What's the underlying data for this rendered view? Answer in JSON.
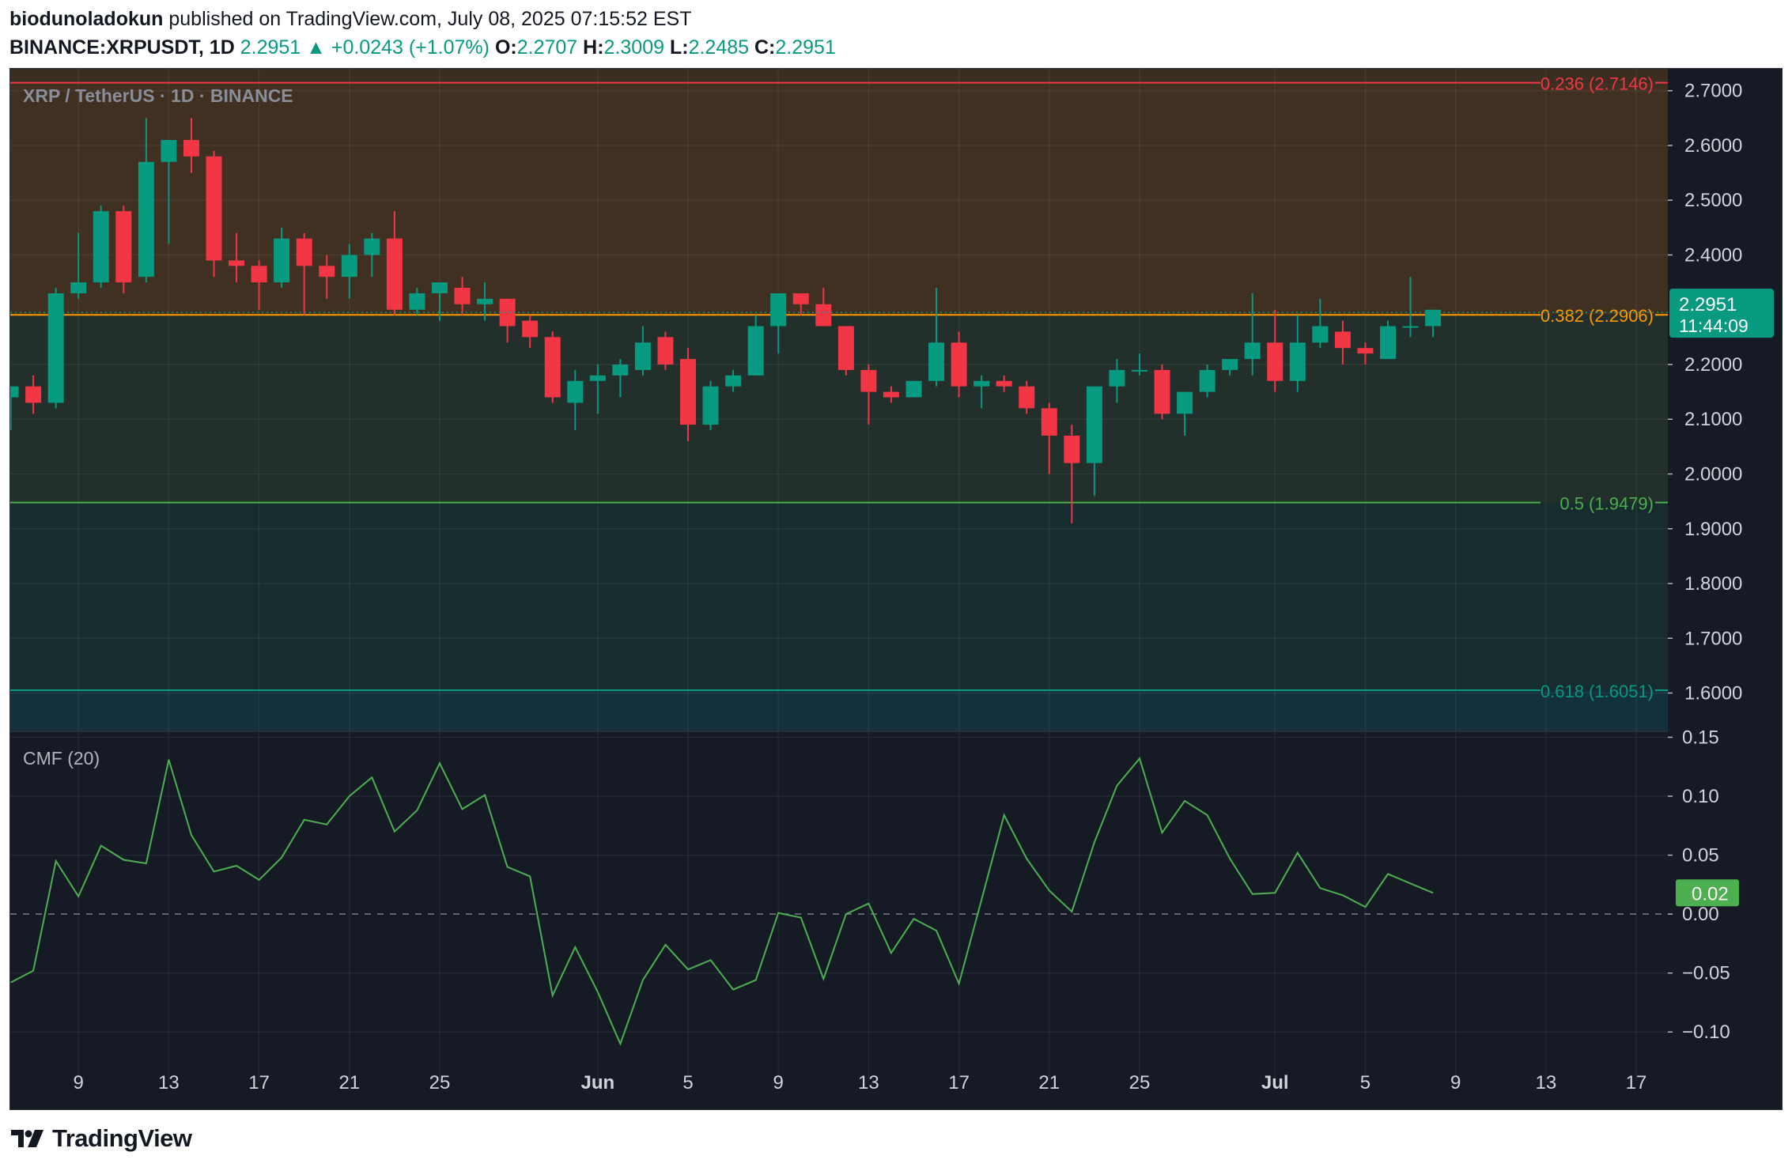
{
  "header": {
    "author": "biodunoladokun",
    "published_text": "published on TradingView.com, July 08, 2025 07:15:52 EST",
    "symbol_line": "BINANCE:XRPUSDT, 1D",
    "last_price": "2.2951",
    "change_arrow": "▲",
    "change": "+0.0243 (+1.07%)",
    "ohlc": [
      {
        "label": "O:",
        "value": "2.2707"
      },
      {
        "label": "H:",
        "value": "2.3009"
      },
      {
        "label": "L:",
        "value": "2.2485"
      },
      {
        "label": "C:",
        "value": "2.2951"
      }
    ]
  },
  "colors": {
    "up": "#089981",
    "down": "#f23645",
    "cmf_line": "#4caf50",
    "fib_0236": "#f23645",
    "fib_0382": "#ff9800",
    "fib_05": "#4caf50",
    "fib_0618": "#089981",
    "price_label_bg": "#089981",
    "cmf_label_bg": "#4caf50"
  },
  "footer": {
    "logo_icon": "tradingview-logo-icon",
    "logo_text": "TradingView"
  },
  "chart_data": [
    {
      "type": "candlestick",
      "title": "XRP / TetherUS · 1D · BINANCE",
      "y_ticks": [
        "2.7000",
        "2.6000",
        "2.5000",
        "2.4000",
        "2.2000",
        "2.1000",
        "2.0000",
        "1.9000",
        "1.8000",
        "1.7000",
        "1.6000"
      ],
      "ylim": [
        1.53,
        2.74
      ],
      "x_tick_labels": [
        {
          "label": "9",
          "day": 6
        },
        {
          "label": "13",
          "day": 10
        },
        {
          "label": "17",
          "day": 14
        },
        {
          "label": "21",
          "day": 18
        },
        {
          "label": "25",
          "day": 22
        },
        {
          "label": "Jun",
          "day": 29
        },
        {
          "label": "5",
          "day": 33
        },
        {
          "label": "9",
          "day": 37
        },
        {
          "label": "13",
          "day": 41
        },
        {
          "label": "17",
          "day": 45
        },
        {
          "label": "21",
          "day": 49
        },
        {
          "label": "25",
          "day": 53
        },
        {
          "label": "Jul",
          "day": 59
        },
        {
          "label": "5",
          "day": 63
        },
        {
          "label": "9",
          "day": 67
        },
        {
          "label": "13",
          "day": 71
        },
        {
          "label": "17",
          "day": 75
        }
      ],
      "x_range_days": [
        2.98,
        76.4
      ],
      "candles": [
        {
          "day": 3,
          "o": 2.14,
          "h": 2.16,
          "l": 2.08,
          "c": 2.16
        },
        {
          "day": 4,
          "o": 2.16,
          "h": 2.18,
          "l": 2.11,
          "c": 2.13
        },
        {
          "day": 5,
          "o": 2.13,
          "h": 2.34,
          "l": 2.12,
          "c": 2.33
        },
        {
          "day": 6,
          "o": 2.33,
          "h": 2.44,
          "l": 2.32,
          "c": 2.35
        },
        {
          "day": 7,
          "o": 2.35,
          "h": 2.49,
          "l": 2.34,
          "c": 2.48
        },
        {
          "day": 8,
          "o": 2.48,
          "h": 2.49,
          "l": 2.33,
          "c": 2.35
        },
        {
          "day": 9,
          "o": 2.36,
          "h": 2.65,
          "l": 2.35,
          "c": 2.57
        },
        {
          "day": 10,
          "o": 2.57,
          "h": 2.61,
          "l": 2.42,
          "c": 2.61
        },
        {
          "day": 11,
          "o": 2.61,
          "h": 2.65,
          "l": 2.55,
          "c": 2.58
        },
        {
          "day": 12,
          "o": 2.58,
          "h": 2.59,
          "l": 2.36,
          "c": 2.39
        },
        {
          "day": 13,
          "o": 2.39,
          "h": 2.44,
          "l": 2.35,
          "c": 2.38
        },
        {
          "day": 14,
          "o": 2.38,
          "h": 2.39,
          "l": 2.3,
          "c": 2.35
        },
        {
          "day": 15,
          "o": 2.35,
          "h": 2.45,
          "l": 2.34,
          "c": 2.43
        },
        {
          "day": 16,
          "o": 2.43,
          "h": 2.44,
          "l": 2.29,
          "c": 2.38
        },
        {
          "day": 17,
          "o": 2.38,
          "h": 2.4,
          "l": 2.32,
          "c": 2.36
        },
        {
          "day": 18,
          "o": 2.36,
          "h": 2.42,
          "l": 2.32,
          "c": 2.4
        },
        {
          "day": 19,
          "o": 2.4,
          "h": 2.44,
          "l": 2.36,
          "c": 2.43
        },
        {
          "day": 20,
          "o": 2.43,
          "h": 2.48,
          "l": 2.29,
          "c": 2.3
        },
        {
          "day": 21,
          "o": 2.3,
          "h": 2.34,
          "l": 2.29,
          "c": 2.33
        },
        {
          "day": 22,
          "o": 2.33,
          "h": 2.35,
          "l": 2.28,
          "c": 2.35
        },
        {
          "day": 23,
          "o": 2.34,
          "h": 2.36,
          "l": 2.29,
          "c": 2.31
        },
        {
          "day": 24,
          "o": 2.31,
          "h": 2.35,
          "l": 2.28,
          "c": 2.32
        },
        {
          "day": 25,
          "o": 2.32,
          "h": 2.32,
          "l": 2.24,
          "c": 2.27
        },
        {
          "day": 26,
          "o": 2.28,
          "h": 2.29,
          "l": 2.23,
          "c": 2.25
        },
        {
          "day": 27,
          "o": 2.25,
          "h": 2.26,
          "l": 2.13,
          "c": 2.14
        },
        {
          "day": 28,
          "o": 2.13,
          "h": 2.19,
          "l": 2.08,
          "c": 2.17
        },
        {
          "day": 29,
          "o": 2.17,
          "h": 2.2,
          "l": 2.11,
          "c": 2.18
        },
        {
          "day": 30,
          "o": 2.18,
          "h": 2.21,
          "l": 2.14,
          "c": 2.2
        },
        {
          "day": 31,
          "o": 2.19,
          "h": 2.27,
          "l": 2.18,
          "c": 2.24
        },
        {
          "day": 32,
          "o": 2.25,
          "h": 2.26,
          "l": 2.19,
          "c": 2.2
        },
        {
          "day": 33,
          "o": 2.21,
          "h": 2.23,
          "l": 2.06,
          "c": 2.09
        },
        {
          "day": 34,
          "o": 2.09,
          "h": 2.17,
          "l": 2.08,
          "c": 2.16
        },
        {
          "day": 35,
          "o": 2.16,
          "h": 2.19,
          "l": 2.15,
          "c": 2.18
        },
        {
          "day": 36,
          "o": 2.18,
          "h": 2.29,
          "l": 2.18,
          "c": 2.27
        },
        {
          "day": 37,
          "o": 2.27,
          "h": 2.33,
          "l": 2.22,
          "c": 2.33
        },
        {
          "day": 38,
          "o": 2.33,
          "h": 2.33,
          "l": 2.29,
          "c": 2.31
        },
        {
          "day": 39,
          "o": 2.31,
          "h": 2.34,
          "l": 2.27,
          "c": 2.27
        },
        {
          "day": 40,
          "o": 2.27,
          "h": 2.27,
          "l": 2.18,
          "c": 2.19
        },
        {
          "day": 41,
          "o": 2.19,
          "h": 2.2,
          "l": 2.09,
          "c": 2.15
        },
        {
          "day": 42,
          "o": 2.15,
          "h": 2.16,
          "l": 2.13,
          "c": 2.14
        },
        {
          "day": 43,
          "o": 2.14,
          "h": 2.17,
          "l": 2.14,
          "c": 2.17
        },
        {
          "day": 44,
          "o": 2.17,
          "h": 2.34,
          "l": 2.16,
          "c": 2.24
        },
        {
          "day": 45,
          "o": 2.24,
          "h": 2.26,
          "l": 2.14,
          "c": 2.16
        },
        {
          "day": 46,
          "o": 2.16,
          "h": 2.18,
          "l": 2.12,
          "c": 2.17
        },
        {
          "day": 47,
          "o": 2.17,
          "h": 2.18,
          "l": 2.15,
          "c": 2.16
        },
        {
          "day": 48,
          "o": 2.16,
          "h": 2.17,
          "l": 2.11,
          "c": 2.12
        },
        {
          "day": 49,
          "o": 2.12,
          "h": 2.13,
          "l": 2.0,
          "c": 2.07
        },
        {
          "day": 50,
          "o": 2.07,
          "h": 2.09,
          "l": 1.91,
          "c": 2.02
        },
        {
          "day": 51,
          "o": 2.02,
          "h": 2.16,
          "l": 1.96,
          "c": 2.16
        },
        {
          "day": 52,
          "o": 2.16,
          "h": 2.21,
          "l": 2.13,
          "c": 2.19
        },
        {
          "day": 53,
          "o": 2.19,
          "h": 2.22,
          "l": 2.18,
          "c": 2.19
        },
        {
          "day": 54,
          "o": 2.19,
          "h": 2.2,
          "l": 2.1,
          "c": 2.11
        },
        {
          "day": 55,
          "o": 2.11,
          "h": 2.14,
          "l": 2.07,
          "c": 2.15
        },
        {
          "day": 56,
          "o": 2.15,
          "h": 2.2,
          "l": 2.14,
          "c": 2.19
        },
        {
          "day": 57,
          "o": 2.19,
          "h": 2.21,
          "l": 2.18,
          "c": 2.21
        },
        {
          "day": 58,
          "o": 2.21,
          "h": 2.33,
          "l": 2.18,
          "c": 2.24
        },
        {
          "day": 59,
          "o": 2.24,
          "h": 2.3,
          "l": 2.15,
          "c": 2.17
        },
        {
          "day": 60,
          "o": 2.17,
          "h": 2.29,
          "l": 2.15,
          "c": 2.24
        },
        {
          "day": 61,
          "o": 2.24,
          "h": 2.32,
          "l": 2.23,
          "c": 2.27
        },
        {
          "day": 62,
          "o": 2.26,
          "h": 2.28,
          "l": 2.2,
          "c": 2.23
        },
        {
          "day": 63,
          "o": 2.23,
          "h": 2.24,
          "l": 2.2,
          "c": 2.22
        },
        {
          "day": 64,
          "o": 2.21,
          "h": 2.28,
          "l": 2.21,
          "c": 2.27
        },
        {
          "day": 65,
          "o": 2.27,
          "h": 2.36,
          "l": 2.25,
          "c": 2.27
        },
        {
          "day": 66,
          "o": 2.27,
          "h": 2.3,
          "l": 2.25,
          "c": 2.3
        }
      ],
      "fibonacci": [
        {
          "label": "0.236 (2.7146)",
          "price": 2.7146,
          "color": "#f23645"
        },
        {
          "label": "0.382 (2.2906)",
          "price": 2.2906,
          "color": "#ff9800"
        },
        {
          "label": "0.5 (1.9479)",
          "price": 1.9479,
          "color": "#4caf50"
        },
        {
          "label": "0.618 (1.6051)",
          "price": 1.6051,
          "color": "#089981"
        }
      ],
      "last_price_label": "2.2951",
      "countdown": "11:44:09"
    },
    {
      "type": "line",
      "title": "CMF (20)",
      "y_ticks": [
        "0.15",
        "0.10",
        "0.05",
        "0.00",
        "−0.05",
        "−0.10"
      ],
      "ylim": [
        -0.128,
        0.155
      ],
      "series": [
        {
          "values": [
            {
              "day": 3,
              "v": -0.058
            },
            {
              "day": 4,
              "v": -0.048
            },
            {
              "day": 5,
              "v": 0.045
            },
            {
              "day": 6,
              "v": 0.015
            },
            {
              "day": 7,
              "v": 0.058
            },
            {
              "day": 8,
              "v": 0.046
            },
            {
              "day": 9,
              "v": 0.043
            },
            {
              "day": 10,
              "v": 0.131
            },
            {
              "day": 11,
              "v": 0.067
            },
            {
              "day": 12,
              "v": 0.036
            },
            {
              "day": 13,
              "v": 0.041
            },
            {
              "day": 14,
              "v": 0.029
            },
            {
              "day": 15,
              "v": 0.048
            },
            {
              "day": 16,
              "v": 0.08
            },
            {
              "day": 17,
              "v": 0.076
            },
            {
              "day": 18,
              "v": 0.1
            },
            {
              "day": 19,
              "v": 0.116
            },
            {
              "day": 20,
              "v": 0.07
            },
            {
              "day": 21,
              "v": 0.088
            },
            {
              "day": 22,
              "v": 0.128
            },
            {
              "day": 23,
              "v": 0.089
            },
            {
              "day": 24,
              "v": 0.101
            },
            {
              "day": 25,
              "v": 0.04
            },
            {
              "day": 26,
              "v": 0.032
            },
            {
              "day": 27,
              "v": -0.069
            },
            {
              "day": 28,
              "v": -0.028
            },
            {
              "day": 29,
              "v": -0.066
            },
            {
              "day": 30,
              "v": -0.11
            },
            {
              "day": 31,
              "v": -0.056
            },
            {
              "day": 32,
              "v": -0.026
            },
            {
              "day": 33,
              "v": -0.047
            },
            {
              "day": 34,
              "v": -0.039
            },
            {
              "day": 35,
              "v": -0.064
            },
            {
              "day": 36,
              "v": -0.056
            },
            {
              "day": 37,
              "v": 0.001
            },
            {
              "day": 38,
              "v": -0.003
            },
            {
              "day": 39,
              "v": -0.055
            },
            {
              "day": 40,
              "v": 0.0
            },
            {
              "day": 41,
              "v": 0.009
            },
            {
              "day": 42,
              "v": -0.033
            },
            {
              "day": 43,
              "v": -0.004
            },
            {
              "day": 44,
              "v": -0.014
            },
            {
              "day": 45,
              "v": -0.059
            },
            {
              "day": 46,
              "v": 0.012
            },
            {
              "day": 47,
              "v": 0.084
            },
            {
              "day": 48,
              "v": 0.047
            },
            {
              "day": 49,
              "v": 0.02
            },
            {
              "day": 50,
              "v": 0.002
            },
            {
              "day": 51,
              "v": 0.061
            },
            {
              "day": 52,
              "v": 0.109
            },
            {
              "day": 53,
              "v": 0.132
            },
            {
              "day": 54,
              "v": 0.069
            },
            {
              "day": 55,
              "v": 0.096
            },
            {
              "day": 56,
              "v": 0.084
            },
            {
              "day": 57,
              "v": 0.047
            },
            {
              "day": 58,
              "v": 0.017
            },
            {
              "day": 59,
              "v": 0.018
            },
            {
              "day": 60,
              "v": 0.052
            },
            {
              "day": 61,
              "v": 0.022
            },
            {
              "day": 62,
              "v": 0.016
            },
            {
              "day": 63,
              "v": 0.006
            },
            {
              "day": 64,
              "v": 0.034
            },
            {
              "day": 65,
              "v": 0.026
            },
            {
              "day": 66,
              "v": 0.018
            }
          ]
        }
      ],
      "last_value_label": "0.02",
      "zero_line": "dashed"
    }
  ]
}
